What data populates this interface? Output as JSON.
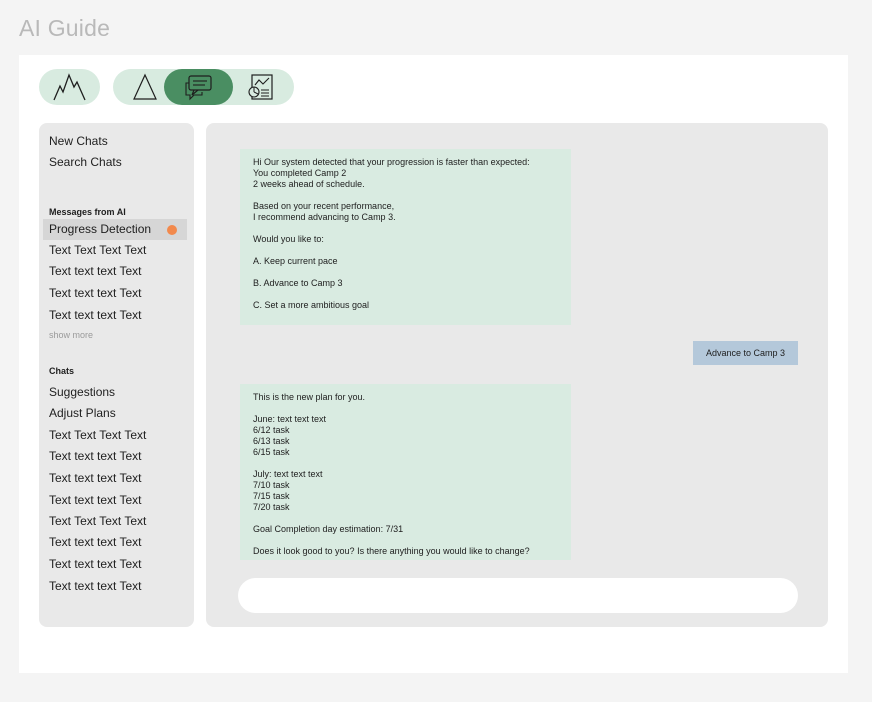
{
  "app": {
    "title": "AI Guide"
  },
  "toolbar": {
    "logo_icon": "mountains-icon",
    "nav": [
      {
        "icon": "triangle-icon",
        "active": false
      },
      {
        "icon": "chat-bubbles-icon",
        "active": true
      },
      {
        "icon": "chart-document-icon",
        "active": false
      }
    ],
    "colors": {
      "pill": "#d8ebe0",
      "active": "#4a8e62"
    }
  },
  "sidebar": {
    "new_chats": "New Chats",
    "search_chats": "Search Chats",
    "messages_heading": "Messages from AI",
    "messages": [
      {
        "label": "Progress Detection",
        "selected": true,
        "unread": true
      },
      {
        "label": "Text Text Text Text"
      },
      {
        "label": "Text text text Text"
      },
      {
        "label": "Text text text Text"
      },
      {
        "label": "Text text text Text"
      }
    ],
    "show_more": "show more",
    "chats_heading": "Chats",
    "chats": [
      {
        "label": "Suggestions"
      },
      {
        "label": "Adjust Plans"
      },
      {
        "label": "Text Text Text Text"
      },
      {
        "label": "Text text text Text"
      },
      {
        "label": "Text text text Text"
      },
      {
        "label": "Text text text Text"
      },
      {
        "label": "Text Text Text Text"
      },
      {
        "label": "Text text text Text"
      },
      {
        "label": "Text text text Text"
      },
      {
        "label": "Text text text Text"
      }
    ],
    "unread_color": "#f2894c"
  },
  "chat": {
    "message_1": {
      "lines": [
        "Hi Our system detected that your progression is faster than expected:",
        "You completed Camp 2",
        "2 weeks ahead of schedule.",
        "",
        "Based on your recent performance,",
        "I recommend advancing to Camp 3.",
        "",
        "Would you like to:",
        "",
        "A. Keep current pace",
        "",
        "B. Advance to Camp 3",
        "",
        "C. Set a more ambitious goal"
      ]
    },
    "user_reply": "Advance to Camp 3",
    "message_2": {
      "lines": [
        "This is the new plan for you.",
        "",
        "June: text text text",
        "6/12 task",
        "6/13 task",
        "6/15 task",
        "",
        "July: text text text",
        "7/10 task",
        "7/15 task",
        "7/20 task",
        "",
        "Goal Completion day estimation: 7/31",
        "",
        "Does it look good to you? Is there anything you would like to change?"
      ]
    },
    "input": {
      "value": "",
      "placeholder": ""
    },
    "colors": {
      "ai_bubble": "#d9ebe1",
      "user_bubble": "#b4c8da"
    }
  }
}
